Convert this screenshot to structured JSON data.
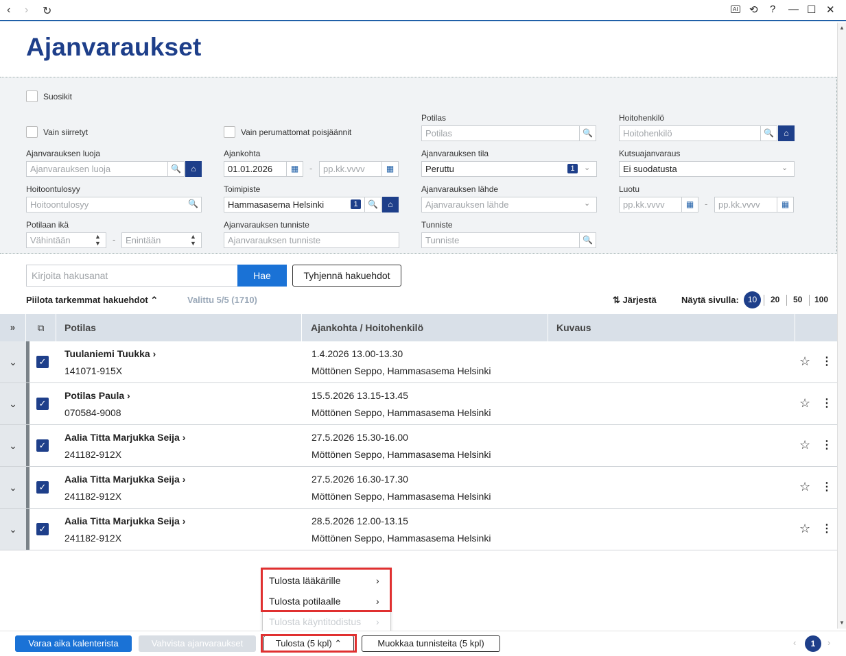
{
  "window": {
    "back_icon": "‹",
    "forward_icon": "›",
    "reload_icon": "↻",
    "ai_icon": "AI",
    "history_icon": "⟲",
    "help_icon": "?",
    "minimize_icon": "—",
    "maximize_icon": "☐",
    "close_icon": "✕"
  },
  "page": {
    "title": "Ajanvaraukset"
  },
  "filters": {
    "favorites_label": "Suosikit",
    "only_transferred_label": "Vain siirretyt",
    "only_uncancelled_label": "Vain perumattomat poisjäännit",
    "patient": {
      "label": "Potilas",
      "placeholder": "Potilas"
    },
    "caregiver": {
      "label": "Hoitohenkilö",
      "placeholder": "Hoitohenkilö"
    },
    "creator": {
      "label": "Ajanvarauksen luoja",
      "placeholder": "Ajanvarauksen luoja"
    },
    "datetime": {
      "label": "Ajankohta",
      "from": "01.01.2026",
      "to_placeholder": "pp.kk.vvvv"
    },
    "status": {
      "label": "Ajanvarauksen tila",
      "value": "Peruttu",
      "count": "1"
    },
    "invite": {
      "label": "Kutsuajanvaraus",
      "value": "Ei suodatusta"
    },
    "reason": {
      "label": "Hoitoontulosyy",
      "placeholder": "Hoitoontulosyy"
    },
    "unit": {
      "label": "Toimipiste",
      "value": "Hammasasema Helsinki",
      "count": "1"
    },
    "source": {
      "label": "Ajanvarauksen lähde",
      "placeholder": "Ajanvarauksen lähde"
    },
    "created": {
      "label": "Luotu",
      "from_placeholder": "pp.kk.vvvv",
      "to_placeholder": "pp.kk.vvvv"
    },
    "age": {
      "label": "Potilaan ikä",
      "min_placeholder": "Vähintään",
      "max_placeholder": "Enintään"
    },
    "booking_id": {
      "label": "Ajanvarauksen tunniste",
      "placeholder": "Ajanvarauksen tunniste"
    },
    "identifier": {
      "label": "Tunniste",
      "placeholder": "Tunniste"
    },
    "dash": "-"
  },
  "search": {
    "placeholder": "Kirjoita hakusanat",
    "submit_label": "Hae",
    "clear_label": "Tyhjennä hakuehdot",
    "hide_label": "Piilota tarkemmat hakuehdot",
    "selected": "Valittu 5/5 (1710)",
    "sort_label": "Järjestä",
    "page_size_label": "Näytä sivulla:",
    "page_sizes": [
      "10",
      "20",
      "50",
      "100"
    ]
  },
  "table": {
    "columns": [
      "Potilas",
      "Ajankohta / Hoitohenkilö",
      "Kuvaus"
    ],
    "rows": [
      {
        "name": "Tuulaniemi Tuukka",
        "ssn": "141071-915X",
        "time": "1.4.2026 13.00-13.30",
        "staff": "Möttönen Seppo, Hammasasema Helsinki"
      },
      {
        "name": "Potilas Paula",
        "ssn": "070584-9008",
        "time": "15.5.2026 13.15-13.45",
        "staff": "Möttönen Seppo, Hammasasema Helsinki"
      },
      {
        "name": "Aalia Titta Marjukka Seija",
        "ssn": "241182-912X",
        "time": "27.5.2026 15.30-16.00",
        "staff": "Möttönen Seppo, Hammasasema Helsinki"
      },
      {
        "name": "Aalia Titta Marjukka Seija",
        "ssn": "241182-912X",
        "time": "27.5.2026 16.30-17.30",
        "staff": "Möttönen Seppo, Hammasasema Helsinki"
      },
      {
        "name": "Aalia Titta Marjukka Seija",
        "ssn": "241182-912X",
        "time": "28.5.2026 12.00-13.15",
        "staff": "Möttönen Seppo, Hammasasema Helsinki"
      }
    ]
  },
  "print_menu": {
    "items": [
      {
        "label": "Tulosta lääkärille",
        "enabled": true
      },
      {
        "label": "Tulosta potilaalle",
        "enabled": true
      },
      {
        "label": "Tulosta käyntitodistus",
        "enabled": false
      }
    ]
  },
  "footer": {
    "book_label": "Varaa aika kalenterista",
    "confirm_label": "Vahvista ajanvaraukset",
    "print_label": "Tulosta (5 kpl)",
    "edit_ids_label": "Muokkaa tunnisteita (5 kpl)",
    "current_page": "1"
  },
  "colors": {
    "brand": "#1e3f8a",
    "primary": "#1a72d6",
    "highlight": "#e03030"
  }
}
